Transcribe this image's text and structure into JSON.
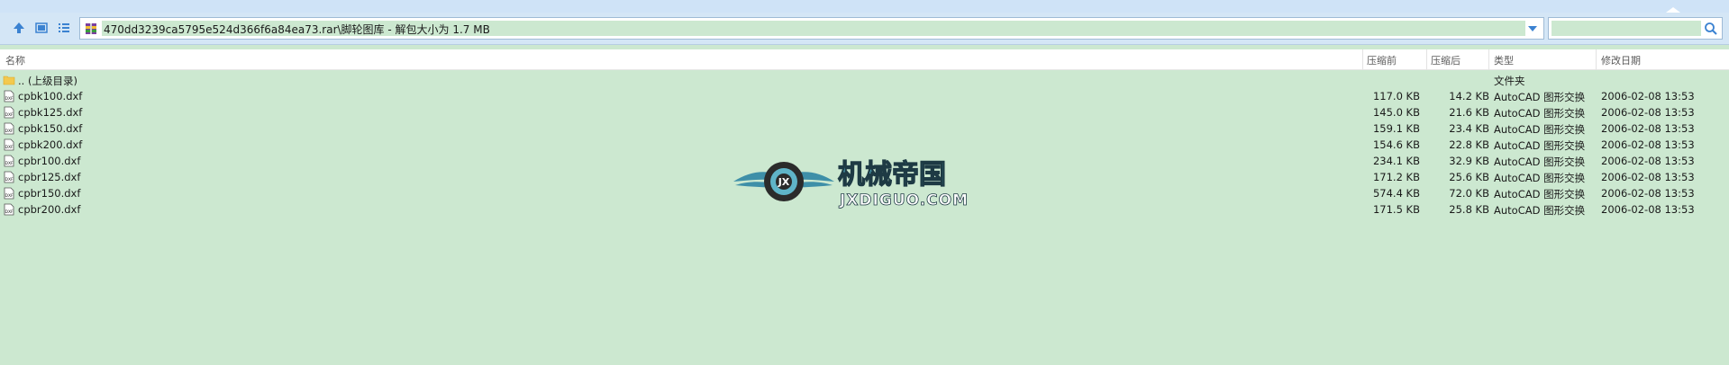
{
  "address": {
    "path": "470dd3239ca5795e524d366f6a84ea73.rar\\脚轮图库 - 解包大小为 1.7 MB"
  },
  "search": {
    "placeholder": ""
  },
  "columns": {
    "name": "名称",
    "packed": "压缩前",
    "size": "压缩后",
    "type": "类型",
    "date": "修改日期"
  },
  "rows": [
    {
      "name": ".. (上级目录)",
      "packed": "",
      "size": "",
      "type": "文件夹",
      "date": "",
      "icon": "folder-icon"
    },
    {
      "name": "cpbk100.dxf",
      "packed": "117.0 KB",
      "size": "14.2 KB",
      "type": "AutoCAD 图形交换",
      "date": "2006-02-08 13:53",
      "icon": "dxf-file-icon"
    },
    {
      "name": "cpbk125.dxf",
      "packed": "145.0 KB",
      "size": "21.6 KB",
      "type": "AutoCAD 图形交换",
      "date": "2006-02-08 13:53",
      "icon": "dxf-file-icon"
    },
    {
      "name": "cpbk150.dxf",
      "packed": "159.1 KB",
      "size": "23.4 KB",
      "type": "AutoCAD 图形交换",
      "date": "2006-02-08 13:53",
      "icon": "dxf-file-icon"
    },
    {
      "name": "cpbk200.dxf",
      "packed": "154.6 KB",
      "size": "22.8 KB",
      "type": "AutoCAD 图形交换",
      "date": "2006-02-08 13:53",
      "icon": "dxf-file-icon"
    },
    {
      "name": "cpbr100.dxf",
      "packed": "234.1 KB",
      "size": "32.9 KB",
      "type": "AutoCAD 图形交换",
      "date": "2006-02-08 13:53",
      "icon": "dxf-file-icon"
    },
    {
      "name": "cpbr125.dxf",
      "packed": "171.2 KB",
      "size": "25.6 KB",
      "type": "AutoCAD 图形交换",
      "date": "2006-02-08 13:53",
      "icon": "dxf-file-icon"
    },
    {
      "name": "cpbr150.dxf",
      "packed": "574.4 KB",
      "size": "72.0 KB",
      "type": "AutoCAD 图形交换",
      "date": "2006-02-08 13:53",
      "icon": "dxf-file-icon"
    },
    {
      "name": "cpbr200.dxf",
      "packed": "171.5 KB",
      "size": "25.8 KB",
      "type": "AutoCAD 图形交换",
      "date": "2006-02-08 13:53",
      "icon": "dxf-file-icon"
    }
  ],
  "watermark": {
    "title": "机械帝国",
    "url": "JXDIGUO.COM"
  },
  "colors": {
    "accent": "#2a7fd4",
    "rowBg": "#cce8d0",
    "toolbarBg": "#d4e6f6"
  }
}
